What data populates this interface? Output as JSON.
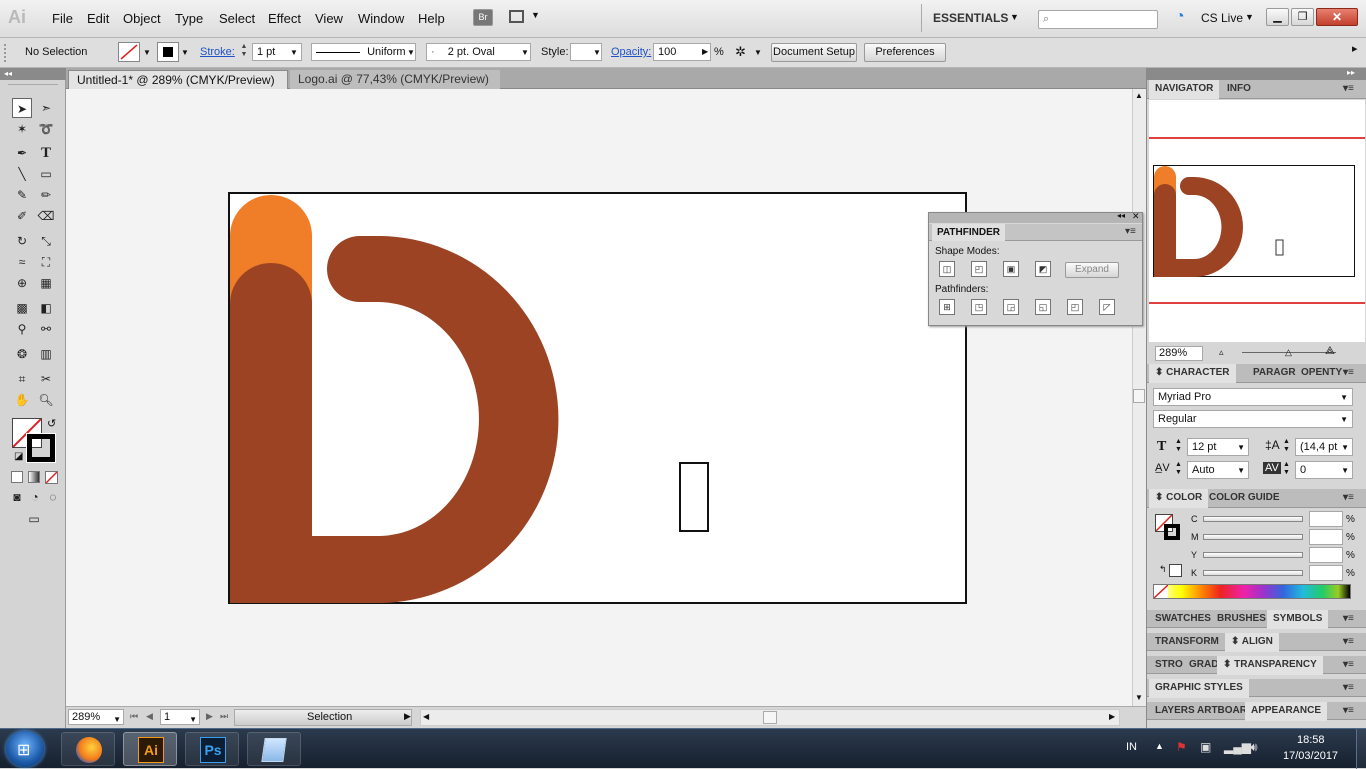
{
  "app": {
    "logo": "Ai",
    "br": "Br"
  },
  "menu": [
    "File",
    "Edit",
    "Object",
    "Type",
    "Select",
    "Effect",
    "View",
    "Window",
    "Help"
  ],
  "workspace": "ESSENTIALS",
  "cslive": "CS Live",
  "control": {
    "selection": "No Selection",
    "stroke_label": "Stroke:",
    "stroke_value": "1 pt",
    "profile": "Uniform",
    "brush": "2 pt. Oval",
    "style_label": "Style:",
    "opacity_label": "Opacity:",
    "opacity_value": "100",
    "percent": "%",
    "doc_setup": "Document Setup",
    "preferences": "Preferences"
  },
  "tabs": [
    {
      "label": "Untitled-1* @ 289% (CMYK/Preview)"
    },
    {
      "label": "Logo.ai @ 77,43% (CMYK/Preview)"
    }
  ],
  "colors": {
    "orange": "#f07d27",
    "brown": "#9c4323",
    "accent_red": "#e04040"
  },
  "pathfinder": {
    "title": "PATHFINDER",
    "shape_modes": "Shape Modes:",
    "expand": "Expand",
    "pathfinders": "Pathfinders:"
  },
  "navigator": {
    "tab1": "NAVIGATOR",
    "tab2": "INFO",
    "zoom": "289%"
  },
  "character": {
    "tab1": "CHARACTER",
    "tab2": "PARAGR",
    "tab3": "OPENTY",
    "font": "Myriad Pro",
    "style": "Regular",
    "size": "12 pt",
    "leading": "(14,4 pt",
    "kerning": "Auto",
    "tracking": "0"
  },
  "color": {
    "tab1": "COLOR",
    "tab2": "COLOR GUIDE",
    "channels": [
      "C",
      "M",
      "Y",
      "K"
    ],
    "percent": "%"
  },
  "panels": {
    "swatches": "SWATCHES",
    "brushes": "BRUSHES",
    "symbols": "SYMBOLS",
    "transform": "TRANSFORM",
    "align": "ALIGN",
    "stroke": "STRO",
    "gradient": "GRAD",
    "transparency": "TRANSPARENCY",
    "graphic_styles": "GRAPHIC STYLES",
    "layers": "LAYERS",
    "artboards": "ARTBOAR",
    "appearance": "APPEARANCE"
  },
  "status": {
    "zoom": "289%",
    "page": "1",
    "tool": "Selection"
  },
  "taskbar": {
    "lang": "IN",
    "time": "18:58",
    "date": "17/03/2017",
    "ai": "Ai",
    "ps": "Ps"
  }
}
